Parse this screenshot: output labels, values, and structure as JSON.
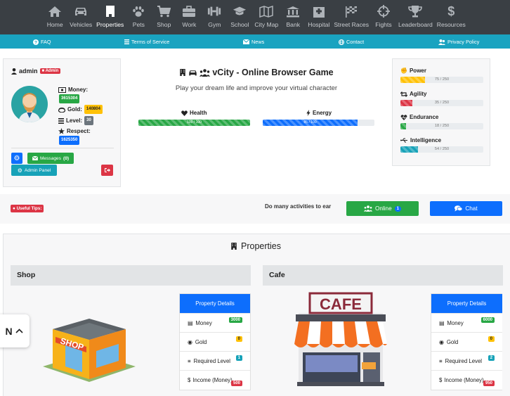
{
  "nav": [
    {
      "label": "Home",
      "icon": "home-icon"
    },
    {
      "label": "Vehicles",
      "icon": "car-icon"
    },
    {
      "label": "Properties",
      "icon": "building-icon",
      "active": true
    },
    {
      "label": "Pets",
      "icon": "paw-icon"
    },
    {
      "label": "Shop",
      "icon": "cart-icon"
    },
    {
      "label": "Work",
      "icon": "briefcase-icon"
    },
    {
      "label": "Gym",
      "icon": "dumbbell-icon"
    },
    {
      "label": "School",
      "icon": "graduation-cap-icon"
    },
    {
      "label": "City Map",
      "icon": "map-icon"
    },
    {
      "label": "Bank",
      "icon": "bank-icon"
    },
    {
      "label": "Hospital",
      "icon": "hospital-icon"
    },
    {
      "label": "Street Races",
      "icon": "checkered-flag-icon"
    },
    {
      "label": "Fights",
      "icon": "crosshairs-icon"
    },
    {
      "label": "Leaderboard",
      "icon": "trophy-icon"
    },
    {
      "label": "Resources",
      "icon": "dollar-icon"
    }
  ],
  "subnav": {
    "faq": "FAQ",
    "terms": "Terms of Service",
    "news": "News",
    "contact": "Contact",
    "privacy": "Privacy Policy"
  },
  "profile": {
    "username": "admin",
    "role_badge": "Admin",
    "money_label": "Money:",
    "money_value": "3615304",
    "gold_label": "Gold:",
    "gold_value": "140804",
    "level_label": "Level:",
    "level_value": "30",
    "respect_label": "Respect:",
    "respect_value": "1625350",
    "messages_label": "Messages",
    "messages_count": "(0)",
    "admin_panel_label": "Admin Panel"
  },
  "game": {
    "title": "vCity - Online Browser Game",
    "subtitle": "Play your dream life and improve your virtual character"
  },
  "vitals": [
    {
      "label": "Health",
      "text": "100 / 100",
      "fraction": 1.0,
      "color": "#28a745",
      "icon": "heart-icon"
    },
    {
      "label": "Energy",
      "text": "85 / 100",
      "fraction": 0.85,
      "color": "#0d6efd",
      "icon": "bolt-icon"
    }
  ],
  "attributes": [
    {
      "label": "Power",
      "text": "75 / 250",
      "fraction": 0.3,
      "color": "#ffc107",
      "icon": "fist-icon"
    },
    {
      "label": "Agility",
      "text": "35 / 250",
      "fraction": 0.14,
      "color": "#dc3545",
      "icon": "retweet-icon"
    },
    {
      "label": "Endurance",
      "text": "18 / 250",
      "fraction": 0.072,
      "color": "#28a745",
      "icon": "heartbeat-icon"
    },
    {
      "label": "Intelligence",
      "text": "54 / 250",
      "fraction": 0.216,
      "color": "#17a2b8",
      "icon": "usb-icon"
    }
  ],
  "tips": {
    "badge": "Useful Tips:",
    "text": "Do many activities to ear"
  },
  "online": {
    "label": "Online",
    "count": "1"
  },
  "chat": {
    "label": "Chat"
  },
  "properties": {
    "heading": "Properties",
    "details_header": "Property Details",
    "items": [
      {
        "name": "Shop",
        "sign": "SHOP",
        "money_label": "Money",
        "money": "3000",
        "gold_label": "Gold",
        "gold": "0",
        "level_label": "Required Level",
        "level": "1",
        "income_label": "Income (Money)",
        "income": "500"
      },
      {
        "name": "Cafe",
        "sign": "CAFE",
        "money_label": "Money",
        "money": "6000",
        "gold_label": "Gold",
        "gold": "0",
        "level_label": "Required Level",
        "level": "2",
        "income_label": "Income (Money)",
        "income": "950"
      }
    ]
  },
  "floater": {
    "text": "N"
  },
  "colors": {
    "nav_bg": "#3a3f44",
    "subnav_bg": "#1aa3c0",
    "primary": "#0d6efd",
    "success": "#28a745",
    "danger": "#dc3545",
    "warning": "#ffc107"
  }
}
